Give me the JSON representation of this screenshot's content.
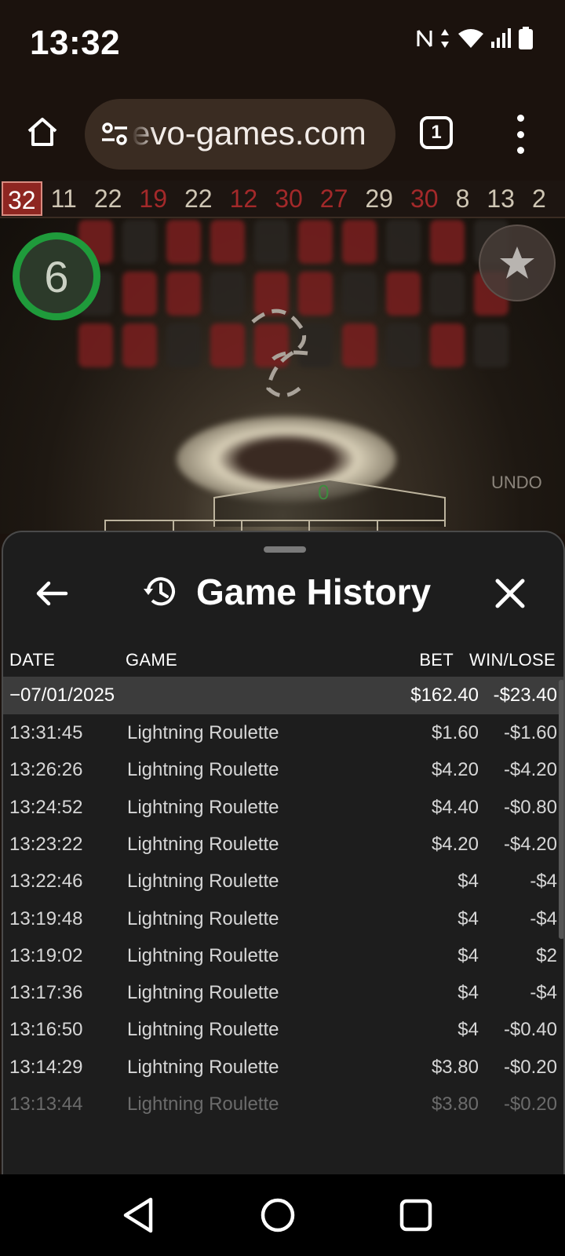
{
  "status_bar": {
    "time": "13:32",
    "icons": [
      "nfc-icon",
      "data-arrows-icon",
      "wifi-icon",
      "signal-icon",
      "battery-icon"
    ]
  },
  "browser": {
    "url": "evo-games.com",
    "tab_count": "1"
  },
  "game": {
    "recent_results": [
      {
        "value": "32",
        "color": "red"
      },
      {
        "value": "11",
        "color": "black"
      },
      {
        "value": "22",
        "color": "black"
      },
      {
        "value": "19",
        "color": "red"
      },
      {
        "value": "22",
        "color": "black"
      },
      {
        "value": "12",
        "color": "red"
      },
      {
        "value": "30",
        "color": "red"
      },
      {
        "value": "27",
        "color": "red"
      },
      {
        "value": "29",
        "color": "black"
      },
      {
        "value": "30",
        "color": "red"
      },
      {
        "value": "8",
        "color": "black"
      },
      {
        "value": "13",
        "color": "black"
      },
      {
        "value": "2",
        "color": "black"
      }
    ],
    "timer": "6",
    "undo_label": "UNDO",
    "zero_label": "0",
    "colors": {
      "red": "#a3292a",
      "timer_green": "#1f9b3b"
    }
  },
  "history": {
    "title": "Game History",
    "columns": {
      "date": "DATE",
      "game": "GAME",
      "bet": "BET",
      "win_lose": "WIN/LOSE"
    },
    "date_group": {
      "date": "−07/01/2025",
      "bet": "$162.40",
      "win_lose": "-$23.40"
    },
    "rows": [
      {
        "time": "13:31:45",
        "game": "Lightning Roulette",
        "bet": "$1.60",
        "win_lose": "-$1.60"
      },
      {
        "time": "13:26:26",
        "game": "Lightning Roulette",
        "bet": "$4.20",
        "win_lose": "-$4.20"
      },
      {
        "time": "13:24:52",
        "game": "Lightning Roulette",
        "bet": "$4.40",
        "win_lose": "-$0.80"
      },
      {
        "time": "13:23:22",
        "game": "Lightning Roulette",
        "bet": "$4.20",
        "win_lose": "-$4.20"
      },
      {
        "time": "13:22:46",
        "game": "Lightning Roulette",
        "bet": "$4",
        "win_lose": "-$4"
      },
      {
        "time": "13:19:48",
        "game": "Lightning Roulette",
        "bet": "$4",
        "win_lose": "-$4"
      },
      {
        "time": "13:19:02",
        "game": "Lightning Roulette",
        "bet": "$4",
        "win_lose": "$2"
      },
      {
        "time": "13:17:36",
        "game": "Lightning Roulette",
        "bet": "$4",
        "win_lose": "-$4"
      },
      {
        "time": "13:16:50",
        "game": "Lightning Roulette",
        "bet": "$4",
        "win_lose": "-$0.40"
      },
      {
        "time": "13:14:29",
        "game": "Lightning Roulette",
        "bet": "$3.80",
        "win_lose": "-$0.20"
      },
      {
        "time": "13:13:44",
        "game": "Lightning Roulette",
        "bet": "$3.80",
        "win_lose": "-$0.20"
      }
    ]
  }
}
